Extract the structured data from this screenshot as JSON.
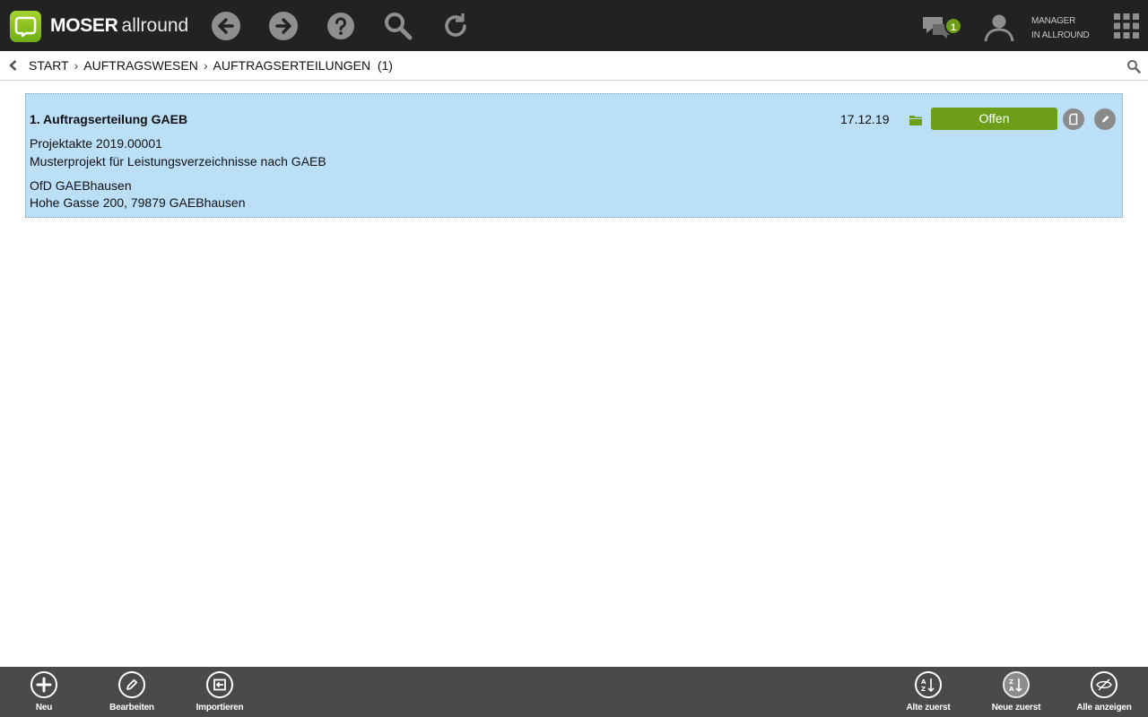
{
  "app": {
    "brand_bold": "MOSER",
    "brand_light": "allround"
  },
  "header": {
    "icons": [
      "back-icon",
      "forward-icon",
      "help-icon",
      "search-icon",
      "refresh-icon"
    ],
    "chat_badge": "1",
    "user_line1": "MANAGER",
    "user_line2": "IN ALLROUND"
  },
  "breadcrumb": {
    "items": [
      "START",
      "AUFTRAGSWESEN",
      "AUFTRAGSERTEILUNGEN"
    ],
    "count": "(1)",
    "separator": "›"
  },
  "record": {
    "title": "1. Auftragserteilung GAEB",
    "date": "17.12.19",
    "status": "Offen",
    "project": "Projektakte 2019.00001",
    "project_desc": "Musterprojekt für Leistungsverzeichnisse nach GAEB",
    "client_name": "OfD GAEBhausen",
    "client_address": "Hohe Gasse 200, 79879 GAEBhausen"
  },
  "toolbar": {
    "new_label": "Neu",
    "edit_label": "Bearbeiten",
    "import_label": "Importieren",
    "old_first_label": "Alte zuerst",
    "new_first_label": "Neue zuerst",
    "show_all_label": "Alle anzeigen"
  },
  "colors": {
    "topbar": "#222222",
    "accent_green": "#6d9e1a",
    "card_bg": "#bcdff8",
    "bottombar": "#4a4a4a"
  }
}
